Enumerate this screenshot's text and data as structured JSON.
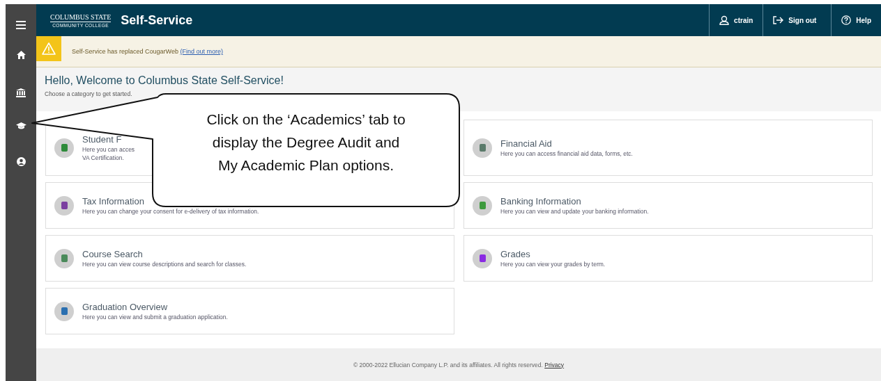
{
  "header": {
    "logo_name": "COLUMBUS STATE",
    "logo_sub": "COMMUNITY COLLEGE",
    "title": "Self-Service",
    "actions": [
      {
        "label": "ctrain",
        "kind": "user"
      },
      {
        "label": "Sign out",
        "kind": "signout"
      },
      {
        "label": "Help",
        "kind": "help"
      }
    ]
  },
  "banner": {
    "text": "Self-Service has replaced CougarWeb ",
    "link": "(Find out more)"
  },
  "welcome": {
    "title": "Hello, Welcome to Columbus State Self-Service!",
    "subtitle": "Choose a category to get started."
  },
  "cards": [
    {
      "title": "Student F",
      "description": [
        "Here you can acces",
        "VA Certification."
      ]
    },
    {
      "title": "Financial Aid",
      "description": [
        "Here you can access financial aid data, forms, etc."
      ]
    },
    {
      "title": "Tax Information",
      "description": [
        "Here you can change your consent for e-delivery of tax information."
      ]
    },
    {
      "title": "Banking Information",
      "description": [
        "Here you can view and update your banking information."
      ]
    },
    {
      "title": "Course Search",
      "description": [
        "Here you can view course descriptions and search for classes."
      ]
    },
    {
      "title": "Grades",
      "description": [
        "Here you can view your grades by term."
      ]
    },
    {
      "title": "Graduation Overview",
      "description": [
        "Here you can view and submit a graduation application."
      ]
    }
  ],
  "callout": {
    "lines": [
      "Click on the ‘Academics’ tab to",
      "display the Degree Audit and",
      "My Academic Plan options."
    ]
  },
  "footer": {
    "text": "© 2000-2022 Ellucian Company L.P. and its affiliates. All rights reserved. ",
    "link": "Privacy"
  }
}
